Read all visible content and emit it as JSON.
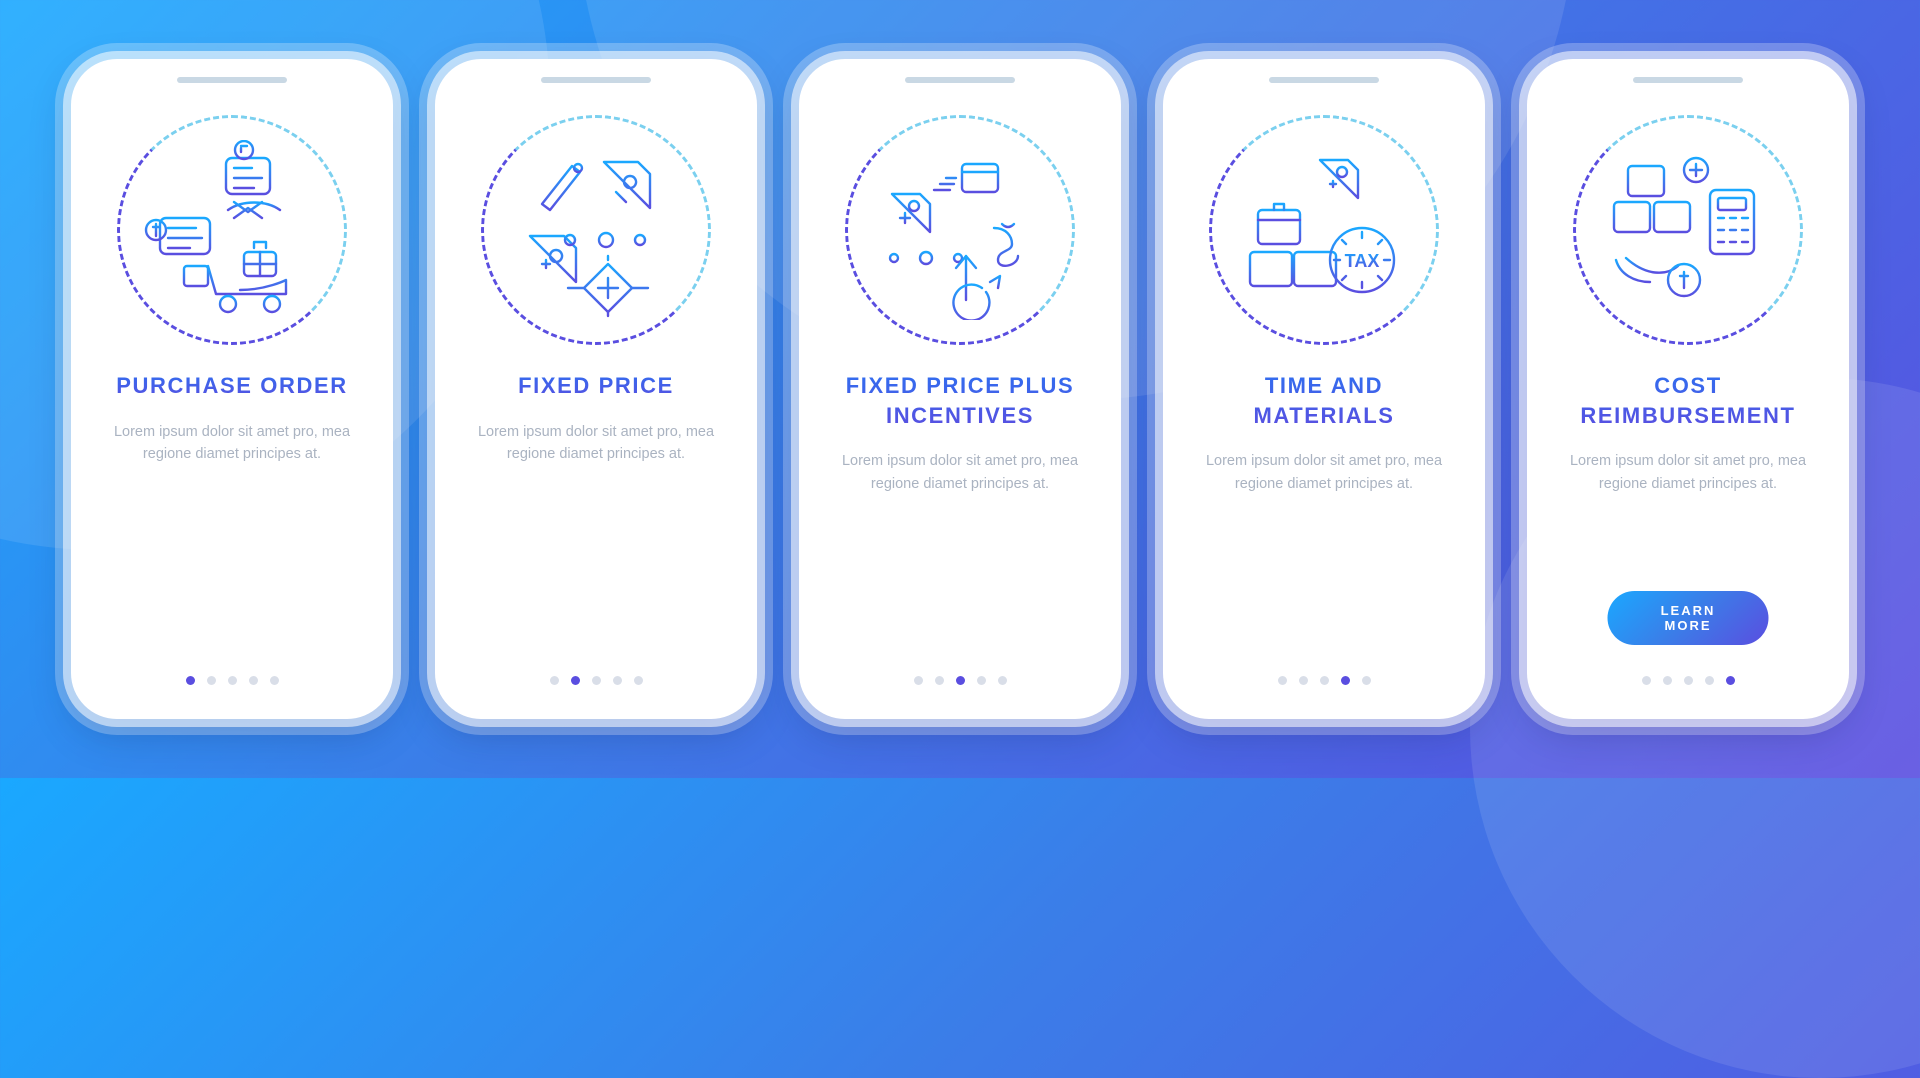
{
  "screens": [
    {
      "key": "purchase-order",
      "title": "PURCHASE ORDER",
      "desc": "Lorem ipsum dolor sit amet pro, mea regione diamet principes at.",
      "activeDot": 0,
      "cta": null
    },
    {
      "key": "fixed-price",
      "title": "FIXED PRICE",
      "desc": "Lorem ipsum dolor sit amet pro, mea regione diamet principes at.",
      "activeDot": 1,
      "cta": null
    },
    {
      "key": "fixed-price-plus-incentives",
      "title": "FIXED PRICE PLUS INCENTIVES",
      "desc": "Lorem ipsum dolor sit amet pro, mea regione diamet principes at.",
      "activeDot": 2,
      "cta": null
    },
    {
      "key": "time-and-materials",
      "title": "TIME AND MATERIALS",
      "desc": "Lorem ipsum dolor sit amet pro, mea regione diamet principes at.",
      "activeDot": 3,
      "cta": null
    },
    {
      "key": "cost-reimbursement",
      "title": "COST REIMBURSEMENT",
      "desc": "Lorem ipsum dolor sit amet pro, mea regione diamet principes at.",
      "activeDot": 4,
      "cta": "LEARN MORE"
    }
  ],
  "dotCount": 5,
  "colors": {
    "gradStart": "#1aa8ff",
    "gradEnd": "#5a4ee0"
  }
}
